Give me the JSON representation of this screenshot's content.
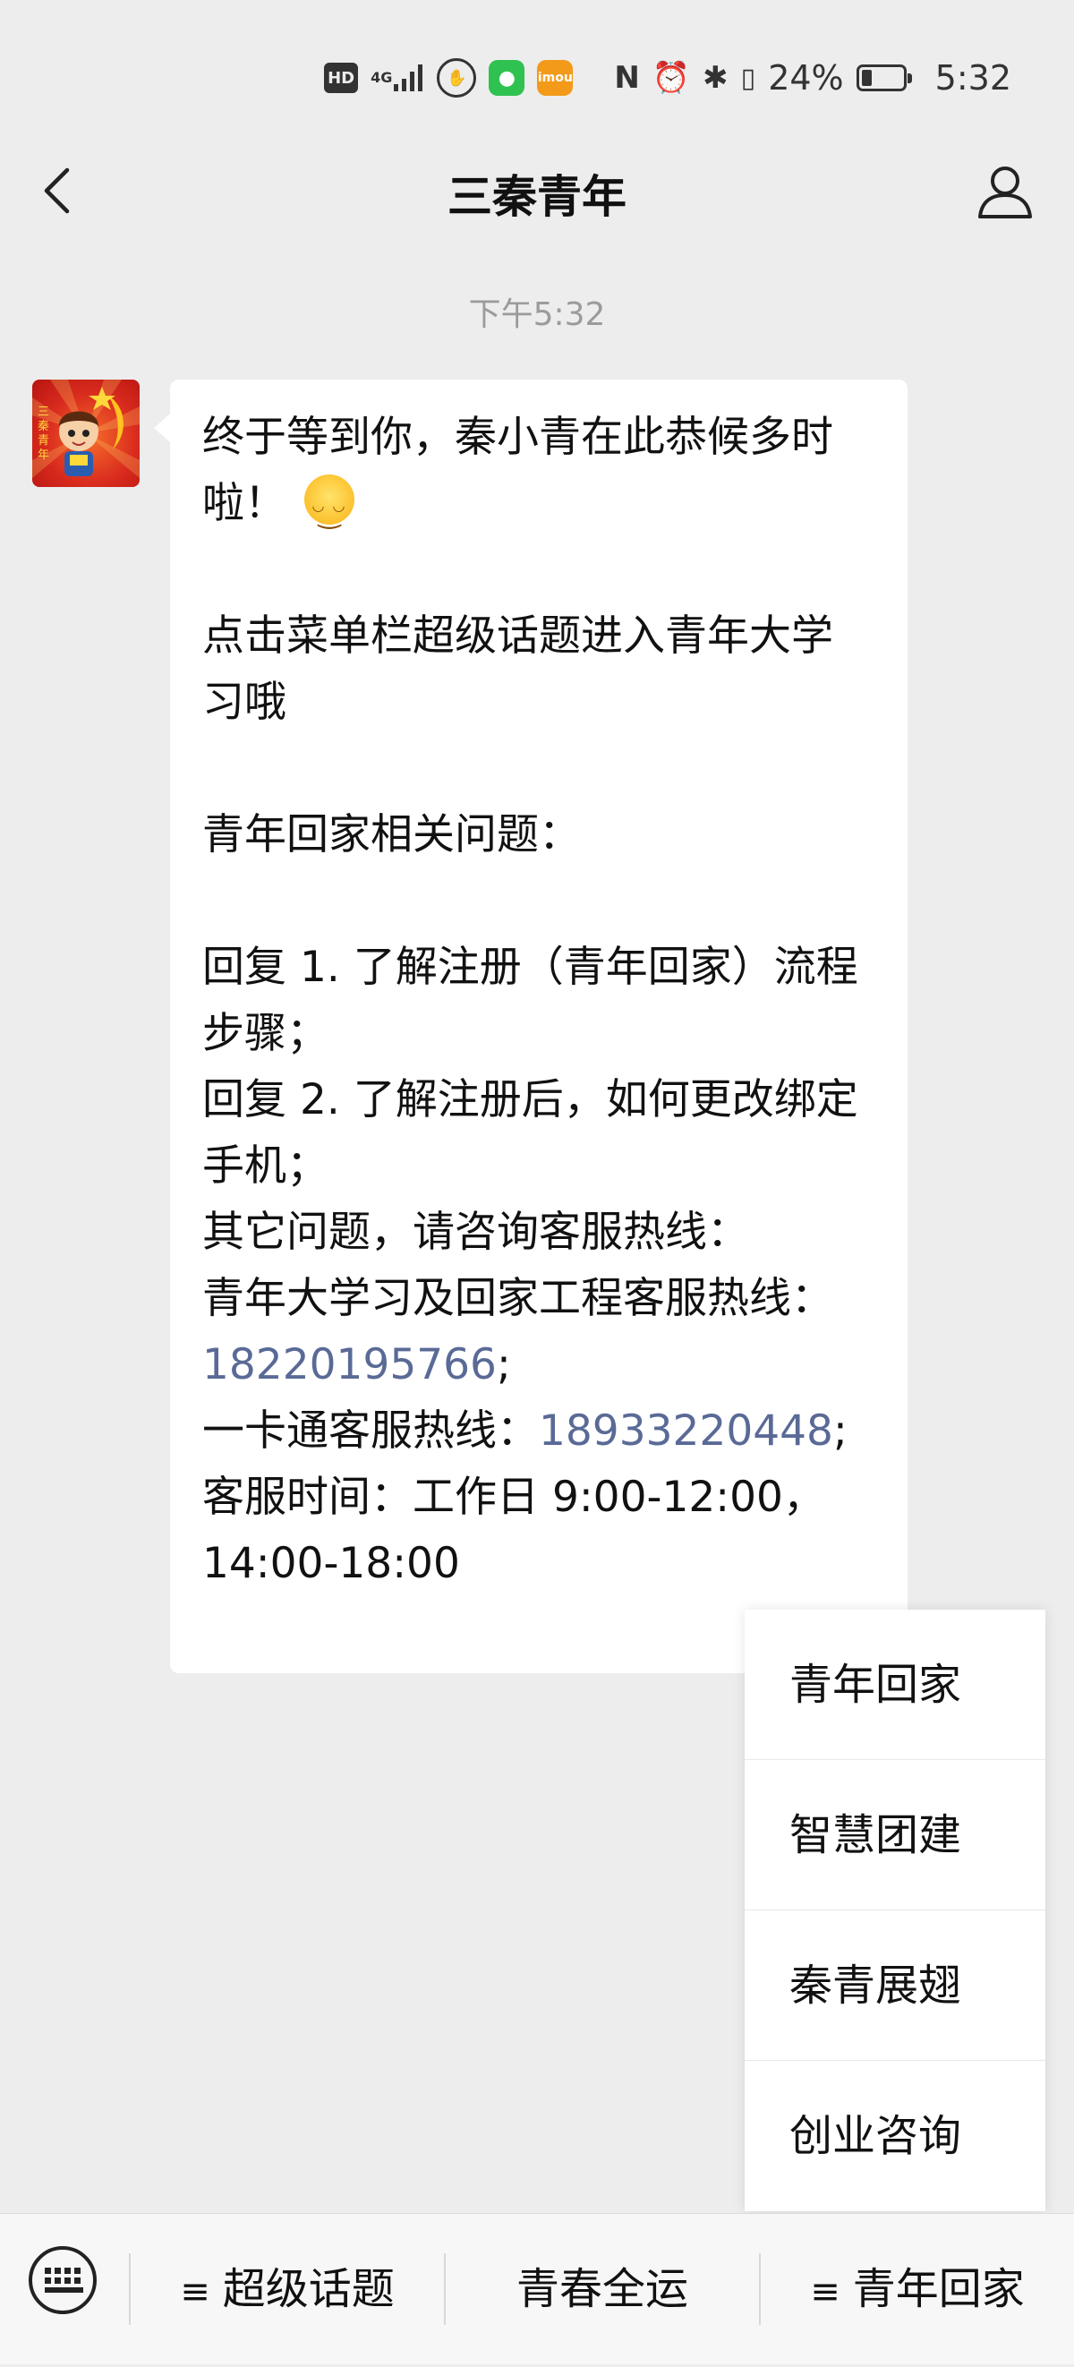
{
  "status_bar": {
    "battery_percent": "24%",
    "battery_level": 0.24,
    "time": "5:32",
    "network": "4G",
    "icons": [
      "hd-icon",
      "signal-icon",
      "hand-icon",
      "wechat-app-icon",
      "imou-app-icon",
      "nfc-icon",
      "alarm-icon",
      "bluetooth-icon",
      "vibrate-icon",
      "battery-icon"
    ]
  },
  "header": {
    "title": "三秦青年",
    "back_icon": "chevron-left-icon",
    "profile_icon": "person-icon"
  },
  "chat": {
    "timestamp": "下午5:32",
    "message": {
      "lines": [
        "终于等到你，秦小青在此恭候多时",
        "啦！",
        "",
        "点击菜单栏超级话题进入青年大学",
        "习哦",
        "",
        "青年回家相关问题：",
        "",
        "回复 1. 了解注册（青年回家）流程",
        "步骤；",
        "回复 2. 了解注册后，如何更改绑定",
        "手机；",
        "其它问题，请咨询客服热线：",
        "青年大学习及回家工程客服热线：",
        "18220195766",
        "一卡通客服热线：",
        "18933220448",
        "客服时间：工作日 9:00-12:00，",
        "14:00-18:00"
      ],
      "semicolon": ";",
      "emoji": "smiling-face-emoji"
    }
  },
  "popup_menu": {
    "items": [
      "青年回家",
      "智慧团建",
      "秦青展翅",
      "创业咨询"
    ]
  },
  "menu_bar": {
    "keyboard_icon": "keyboard-icon",
    "items": [
      {
        "icon": "≡",
        "label": "超级话题"
      },
      {
        "icon": "",
        "label": "青春全运"
      },
      {
        "icon": "≡",
        "label": "青年回家"
      }
    ]
  }
}
